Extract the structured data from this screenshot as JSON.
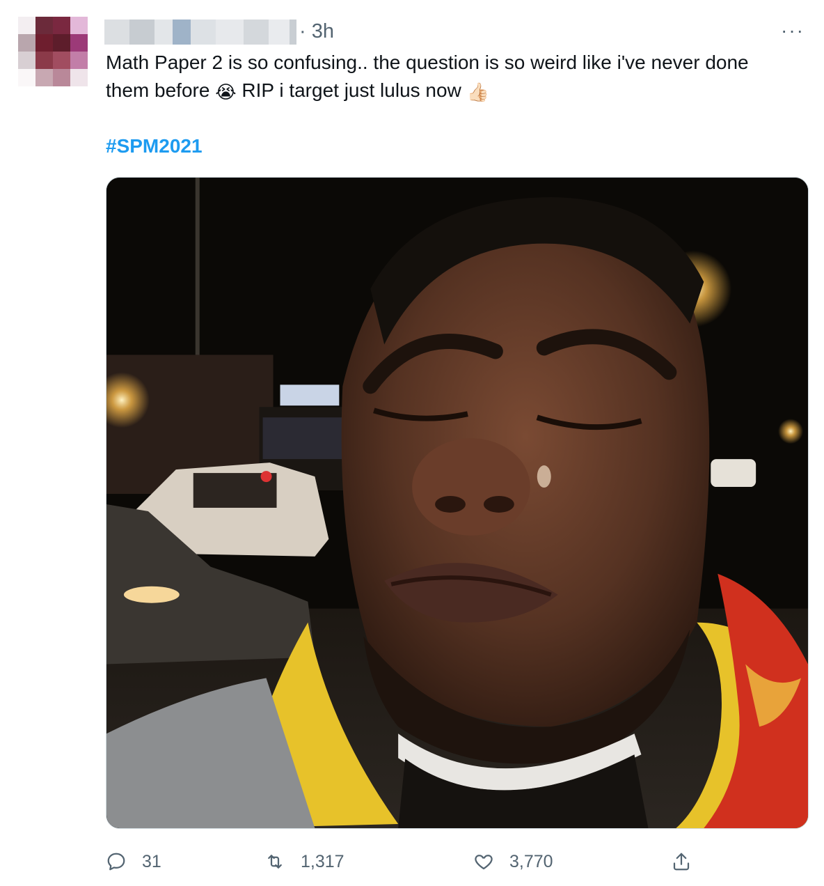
{
  "tweet": {
    "time": "· 3h",
    "text_line1": "Math Paper 2 is so confusing.. the question is so weird like i've never done",
    "text_line2_a": "them before",
    "emoji_crying": "😭",
    "text_line2_b": "RIP i target just lulus now",
    "emoji_thumbs": "👍🏻",
    "hashtag": "#SPM2021",
    "more_label": "···"
  },
  "actions": {
    "replies": "31",
    "retweets": "1,317",
    "likes": "3,770"
  },
  "icons": {
    "reply": "reply-icon",
    "retweet": "retweet-icon",
    "like": "heart-icon",
    "share": "share-icon",
    "more": "more-icon"
  },
  "colors": {
    "hashtag": "#1d9bf0",
    "muted": "#536471",
    "text": "#0f1419"
  }
}
